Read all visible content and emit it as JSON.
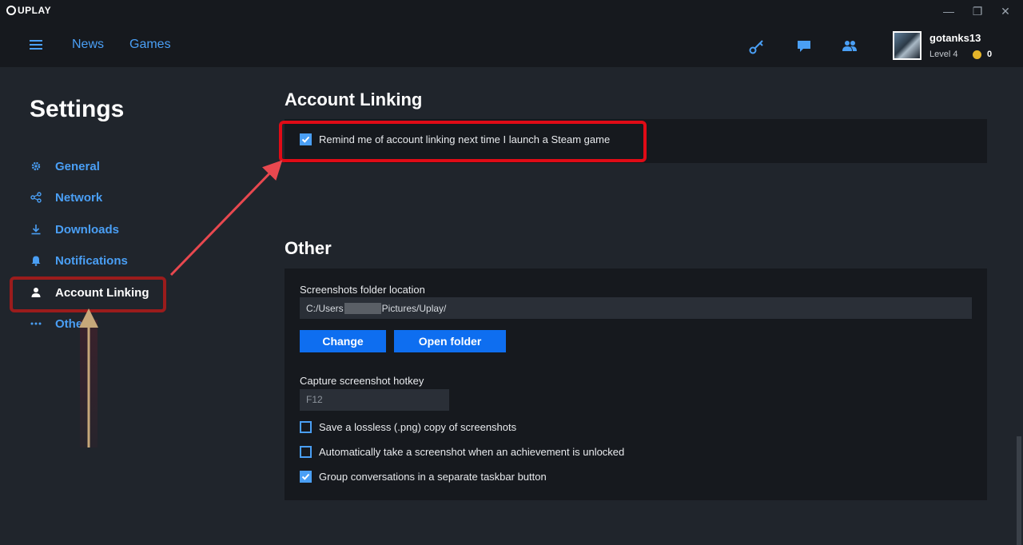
{
  "window": {
    "app_name": "UPLAY",
    "controls": {
      "minimize": "—",
      "restore": "❐",
      "close": "✕"
    }
  },
  "nav": {
    "links": [
      "News",
      "Games"
    ],
    "icons": [
      "key-icon",
      "chat-icon",
      "friends-icon"
    ]
  },
  "user": {
    "name": "gotanks13",
    "level": "Level 4",
    "coins": "0"
  },
  "sidebar": {
    "title": "Settings",
    "items": [
      {
        "label": "General",
        "icon": "gear-icon"
      },
      {
        "label": "Network",
        "icon": "network-icon"
      },
      {
        "label": "Downloads",
        "icon": "download-icon"
      },
      {
        "label": "Notifications",
        "icon": "bell-icon"
      },
      {
        "label": "Account Linking",
        "icon": "user-icon",
        "active": true
      },
      {
        "label": "Other",
        "icon": "dots-icon"
      }
    ]
  },
  "account_linking": {
    "title": "Account Linking",
    "remind_label": "Remind me of account linking next time I launch a Steam game",
    "remind_checked": true
  },
  "other": {
    "title": "Other",
    "screenshots_label": "Screenshots folder location",
    "path_prefix": "C:/Users",
    "path_suffix": "Pictures/Uplay/",
    "change_button": "Change",
    "open_folder_button": "Open folder",
    "hotkey_label": "Capture screenshot hotkey",
    "hotkey_value": "F12",
    "options": [
      {
        "label": "Save a lossless (.png) copy of screenshots",
        "checked": false
      },
      {
        "label": "Automatically take a screenshot when an achievement is unlocked",
        "checked": false
      },
      {
        "label": "Group conversations in a separate taskbar button",
        "checked": true
      }
    ]
  },
  "colors": {
    "accent": "#4a9ff5",
    "button": "#0e6ef0",
    "annotation_red": "#e00b16",
    "annotation_tan": "#c7a77a"
  }
}
